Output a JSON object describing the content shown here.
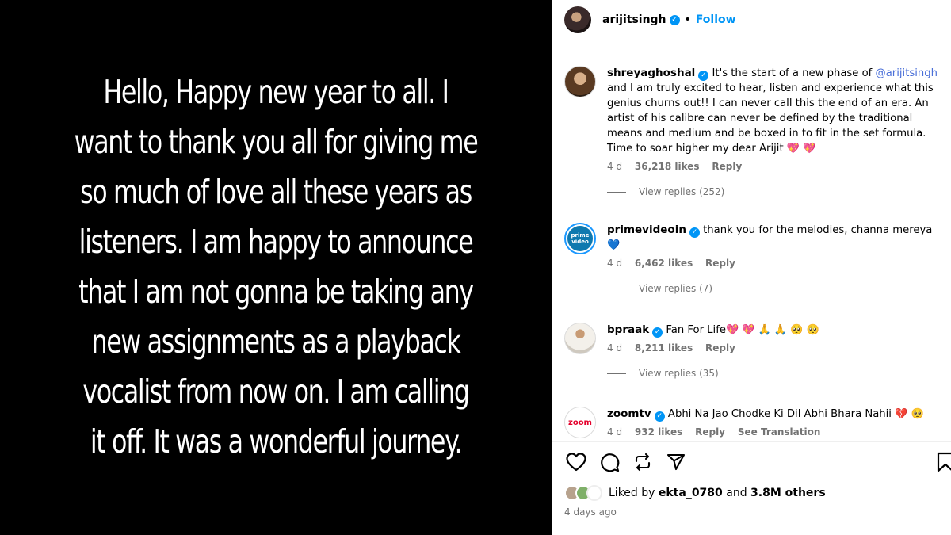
{
  "story": {
    "text": "Hello, Happy new year to all. I\nwant to thank you all for giving me\nso much of love all these years as\nlisteners. I am happy to announce\nthat I am not gonna be taking any\nnew assignments as a playback\nvocalist from now on. I am calling\nit off. It was a wonderful journey."
  },
  "header": {
    "username": "arijitsingh",
    "separator": "•",
    "follow_label": "Follow",
    "verified_glyph": "✓"
  },
  "comments": [
    {
      "username": "shreyaghoshal",
      "text_before": " It's the start of a new phase of ",
      "mention": "@arijitsingh",
      "text_after": " and I am truly excited to hear, listen and experience what this genius churns out!! I can never call this the end of an era. An artist of his calibre can never be defined by the traditional means and medium and be boxed in to fit in the set formula. Time to soar higher my dear Arijit ",
      "emojis": "💖 💖",
      "age": "4 d",
      "likes": "36,218 likes",
      "reply": "Reply",
      "view_replies": "View replies (252)"
    },
    {
      "username": "primevideoin",
      "avatar_text": "prime video",
      "text": " thank you for the melodies, channa mereya",
      "emojis": "💙",
      "age": "4 d",
      "likes": "6,462 likes",
      "reply": "Reply",
      "view_replies": "View replies (7)"
    },
    {
      "username": "bpraak",
      "text": " Fan For Life",
      "emojis": "💖 💖 🙏 🙏 🥺 🥺",
      "age": "4 d",
      "likes": "8,211 likes",
      "reply": "Reply",
      "view_replies": "View replies (35)"
    },
    {
      "username": "zoomtv",
      "avatar_text": "zoom",
      "text": " Abhi Na Jao Chodke Ki Dil Abhi Bhara Nahii ",
      "emojis": "💔 🥺",
      "age": "4 d",
      "likes": "932 likes",
      "reply": "Reply",
      "see_translation": "See Translation"
    }
  ],
  "likes": {
    "prefix": "Liked by ",
    "user": "ekta_0780",
    "middle": " and ",
    "others": "3.8M others"
  },
  "time": "4 days ago",
  "colors": {
    "accent": "#0095f6",
    "muted": "#737373",
    "heart": "#ed4956"
  }
}
